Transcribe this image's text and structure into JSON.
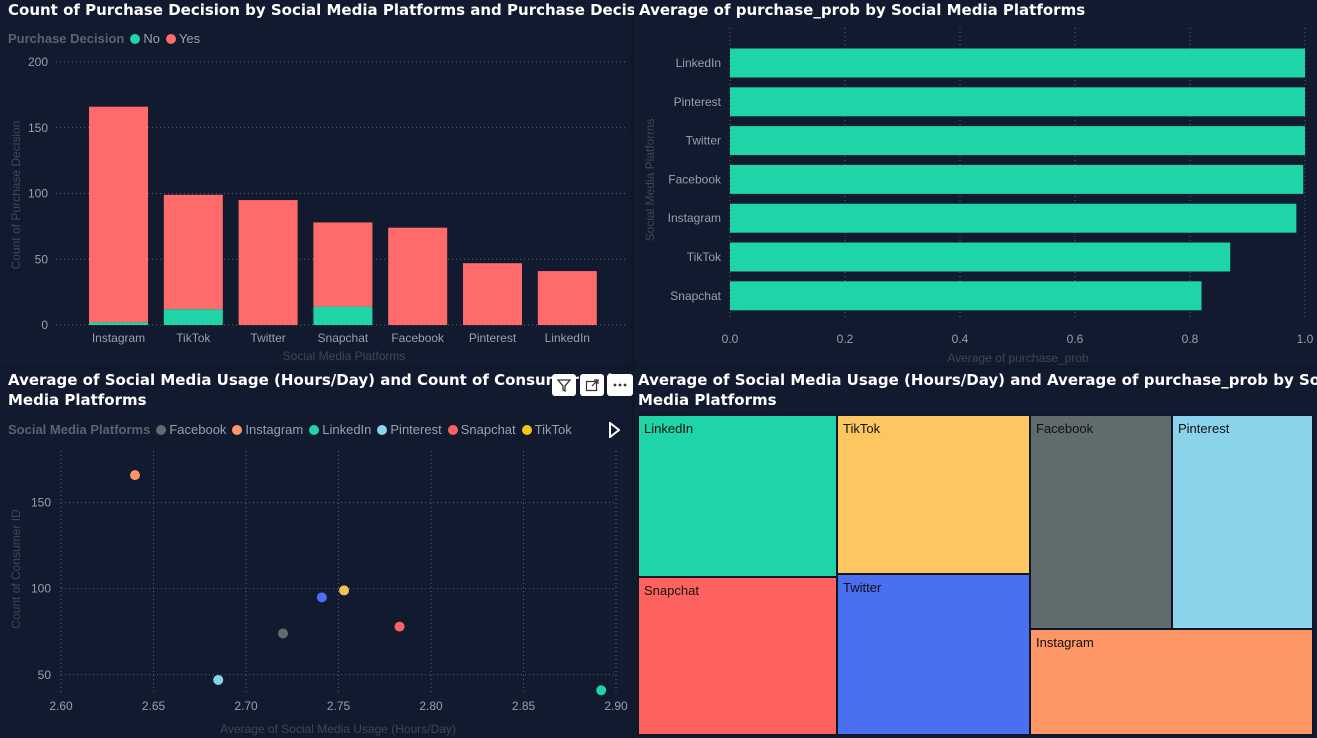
{
  "colors": {
    "no": "#1fd4a6",
    "yes": "#ff6b6b",
    "bar": "#1fd4a6",
    "bg": "#111a2e"
  },
  "panel1": {
    "title": "Count of Purchase Decision by Social Media Platforms and Purchase Decision",
    "legend_title": "Purchase Decision",
    "legend": [
      {
        "name": "No",
        "color": "#1fd4a6"
      },
      {
        "name": "Yes",
        "color": "#ff6b6b"
      }
    ],
    "xlabel": "Social Media Platforms",
    "ylabel": "Count of Purchase Decision"
  },
  "panel2": {
    "title": "Average of purchase_prob by Social Media Platforms",
    "xlabel": "Average of purchase_prob",
    "ylabel": "Social Media Platforms"
  },
  "panel3": {
    "title_line1": "Average of Social Media Usage (Hours/Day) and Count of Consumer ID b",
    "title_line2": "Media Platforms",
    "legend_title": "Social Media Platforms",
    "legend": [
      {
        "name": "Facebook",
        "color": "#5f6b6d"
      },
      {
        "name": "Instagram",
        "color": "#fe9666"
      },
      {
        "name": "LinkedIn",
        "color": "#1fd4a6"
      },
      {
        "name": "Pinterest",
        "color": "#8ad4eb"
      },
      {
        "name": "Snapchat",
        "color": "#fd625e"
      },
      {
        "name": "TikTok",
        "color": "#f2c80f"
      }
    ],
    "xlabel": "Average of Social Media Usage (Hours/Day)",
    "ylabel": "Count of Consumer ID"
  },
  "panel4": {
    "title_line1": "Average of Social Media Usage (Hours/Day) and Average of purchase_prob by Social",
    "title_line2": "Media Platforms"
  },
  "chart_data": [
    {
      "type": "bar",
      "stacked": true,
      "title": "Count of Purchase Decision by Social Media Platforms and Purchase Decision",
      "xlabel": "Social Media Platforms",
      "ylabel": "Count of Purchase Decision",
      "categories": [
        "Instagram",
        "TikTok",
        "Twitter",
        "Snapchat",
        "Facebook",
        "Pinterest",
        "LinkedIn"
      ],
      "series": [
        {
          "name": "No",
          "values": [
            2,
            12,
            0,
            14,
            0,
            0,
            0
          ]
        },
        {
          "name": "Yes",
          "values": [
            164,
            87,
            95,
            64,
            74,
            47,
            41
          ]
        }
      ],
      "ylim": [
        0,
        200
      ],
      "yticks": [
        0,
        50,
        100,
        150,
        200
      ],
      "grid": true,
      "legend": "top-left"
    },
    {
      "type": "bar",
      "orientation": "horizontal",
      "title": "Average of purchase_prob by Social Media Platforms",
      "xlabel": "Average of purchase_prob",
      "ylabel": "Social Media Platforms",
      "categories": [
        "LinkedIn",
        "Pinterest",
        "Twitter",
        "Facebook",
        "Instagram",
        "TikTok",
        "Snapchat"
      ],
      "values": [
        1.0,
        1.0,
        1.0,
        0.997,
        0.985,
        0.87,
        0.82
      ],
      "xlim": [
        0,
        1.0
      ],
      "xticks": [
        "0.0",
        "0.2",
        "0.4",
        "0.6",
        "0.8",
        "1.0"
      ],
      "grid": true
    },
    {
      "type": "scatter",
      "title": "Average of Social Media Usage (Hours/Day) and Count of Consumer ID by Social Media Platforms",
      "xlabel": "Average of Social Media Usage (Hours/Day)",
      "ylabel": "Count of Consumer ID",
      "xlim": [
        2.6,
        2.9
      ],
      "ylim": [
        40,
        180
      ],
      "xticks": [
        "2.60",
        "2.65",
        "2.70",
        "2.75",
        "2.80",
        "2.85",
        "2.90"
      ],
      "yticks": [
        50,
        100,
        150
      ],
      "points": [
        {
          "name": "Instagram",
          "x": 2.64,
          "y": 166,
          "color": "#fe9666"
        },
        {
          "name": "Twitter",
          "x": 2.741,
          "y": 95,
          "color": "#4a6ff0"
        },
        {
          "name": "TikTok",
          "x": 2.753,
          "y": 99,
          "color": "#f5c05a"
        },
        {
          "name": "Facebook",
          "x": 2.72,
          "y": 74,
          "color": "#5f6b6d"
        },
        {
          "name": "Snapchat",
          "x": 2.783,
          "y": 78,
          "color": "#fd625e"
        },
        {
          "name": "Pinterest",
          "x": 2.685,
          "y": 47,
          "color": "#8ad4eb"
        },
        {
          "name": "LinkedIn",
          "x": 2.892,
          "y": 41,
          "color": "#1fd4a6"
        }
      ],
      "grid": true,
      "legend": "top-left"
    },
    {
      "type": "treemap",
      "title": "Average of Social Media Usage (Hours/Day) and Average of purchase_prob by Social Media Platforms",
      "items": [
        {
          "name": "LinkedIn",
          "color": "#1fd4a6"
        },
        {
          "name": "Snapchat",
          "color": "#fd625e"
        },
        {
          "name": "TikTok",
          "color": "#fdc661"
        },
        {
          "name": "Twitter",
          "color": "#4a6ff0"
        },
        {
          "name": "Facebook",
          "color": "#5f6b6d"
        },
        {
          "name": "Pinterest",
          "color": "#8ad4eb"
        },
        {
          "name": "Instagram",
          "color": "#fe9666"
        }
      ]
    }
  ]
}
